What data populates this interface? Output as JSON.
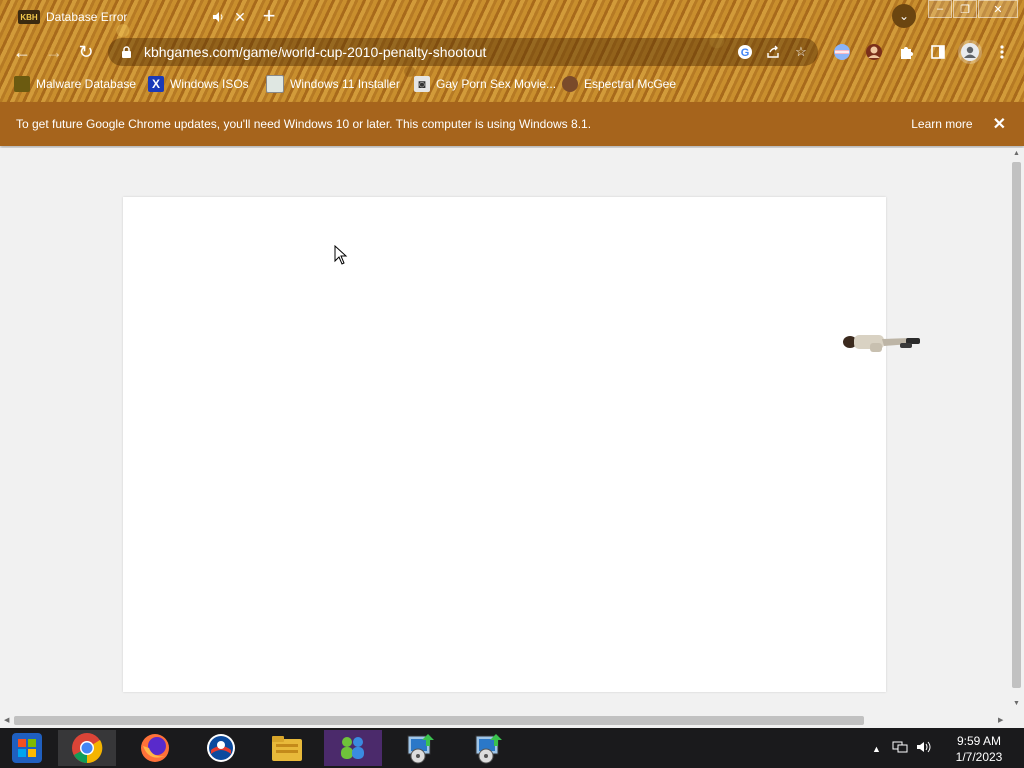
{
  "browser": {
    "tab": {
      "favicon_text": "KBH",
      "title": "Database Error",
      "audio_icon": "speaker-icon",
      "close_glyph": "✕"
    },
    "new_tab_glyph": "+",
    "tab_search_glyph": "⌄",
    "window": {
      "minimize": "–",
      "restore": "❐",
      "close": "✕"
    },
    "nav": {
      "back": "←",
      "forward": "→",
      "reload": "↻"
    },
    "url": "kbhgames.com/game/world-cup-2010-penalty-shootout",
    "omnibox_icons": [
      "google-lens-icon",
      "share-icon",
      "bookmark-star-icon"
    ],
    "extensions": [
      "translate-extension-icon",
      "avatar-extension-icon",
      "puzzle-extensions-icon",
      "side-panel-icon",
      "profile-icon",
      "menu-icon"
    ],
    "bookmarks": [
      {
        "label": "Malware Database",
        "icon": "shield-bookmark-icon"
      },
      {
        "label": "Windows ISOs",
        "icon": "x-bookmark-icon"
      },
      {
        "label": "Windows 11 Installer",
        "icon": "image-bookmark-icon"
      },
      {
        "label": "Gay Porn Sex Movie...",
        "icon": "film-bookmark-icon"
      },
      {
        "label": "Espectral McGee",
        "icon": "face-bookmark-icon"
      }
    ]
  },
  "infobar": {
    "message": "To get future Google Chrome updates, you'll need Windows 10 or later. This computer is using Windows 8.1.",
    "learn_more": "Learn more",
    "close_glyph": "✕"
  },
  "page": {
    "game_area": "white canvas",
    "sprite": "fallen-player-sprite"
  },
  "taskbar": {
    "apps": [
      "start-orb",
      "chrome",
      "firefox",
      "outlook",
      "file-explorer",
      "msn-messenger",
      "installer",
      "installer-2"
    ],
    "time": "9:59 AM",
    "date": "1/7/2023"
  },
  "colors": {
    "infobar": "#a6641c",
    "taskbar": "#1a1a1c",
    "content_bg": "#f1f1f1"
  }
}
